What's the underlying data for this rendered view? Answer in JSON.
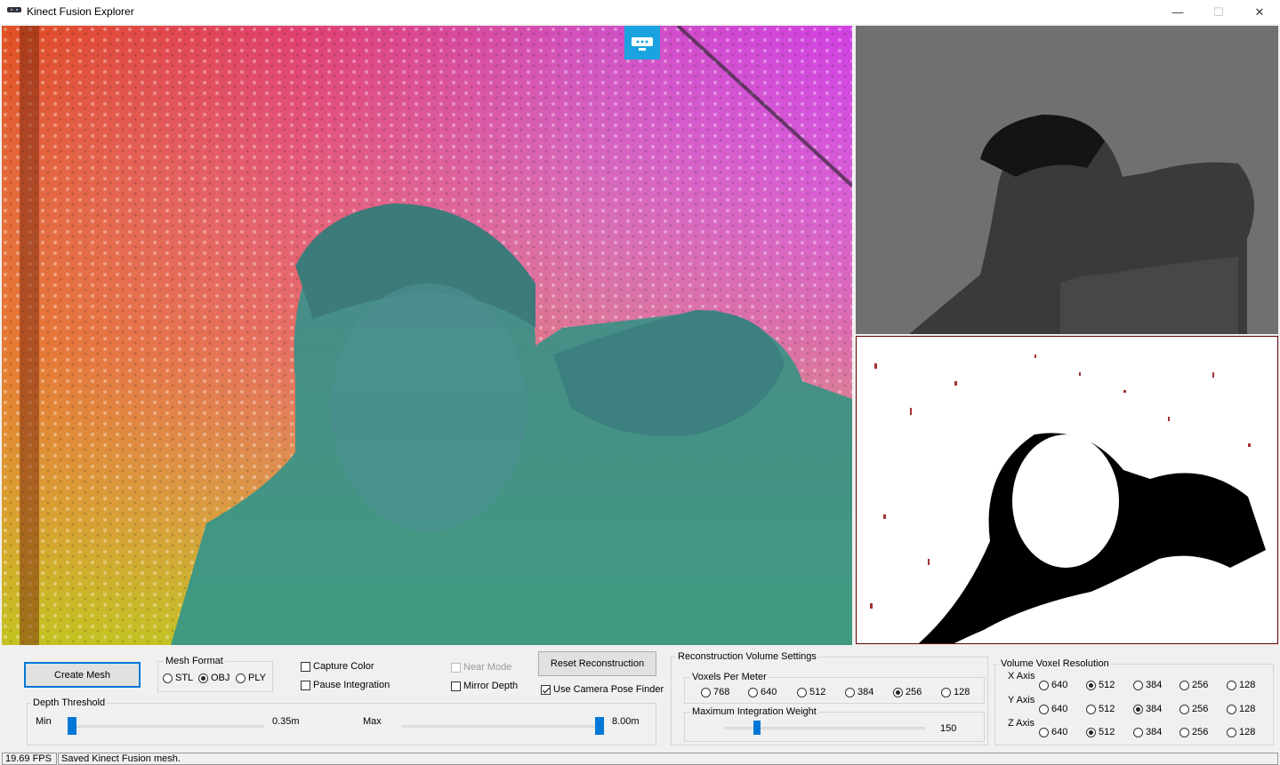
{
  "window": {
    "title": "Kinect Fusion Explorer",
    "minimize": "—",
    "maximize": "☐",
    "close": "✕"
  },
  "toolbar": {
    "create_mesh": "Create Mesh",
    "reset_reconstruction": "Reset Reconstruction"
  },
  "mesh_format": {
    "title": "Mesh Format",
    "options": [
      {
        "label": "STL",
        "selected": false
      },
      {
        "label": "OBJ",
        "selected": true
      },
      {
        "label": "PLY",
        "selected": false
      }
    ]
  },
  "checkboxes": {
    "capture_color": {
      "label": "Capture Color",
      "checked": false
    },
    "pause_integration": {
      "label": "Pause Integration",
      "checked": false
    },
    "near_mode": {
      "label": "Near Mode",
      "checked": false,
      "disabled": true
    },
    "mirror_depth": {
      "label": "Mirror Depth",
      "checked": false
    },
    "use_camera_pose_finder": {
      "label": "Use Camera Pose Finder",
      "checked": true
    }
  },
  "depth_threshold": {
    "title": "Depth Threshold",
    "min_label": "Min",
    "min_value": "0.35m",
    "max_label": "Max",
    "max_value": "8.00m",
    "min_fraction": 0.0,
    "max_fraction": 1.0
  },
  "reconstruction": {
    "title": "Reconstruction Volume Settings",
    "voxels_per_meter": {
      "title": "Voxels Per Meter",
      "options": [
        "768",
        "640",
        "512",
        "384",
        "256",
        "128"
      ],
      "selected": "256"
    },
    "max_integration_weight": {
      "title": "Maximum Integration Weight",
      "value": "150",
      "fraction": 0.15
    }
  },
  "voxel_resolution": {
    "title": "Volume Voxel Resolution",
    "options": [
      "640",
      "512",
      "384",
      "256",
      "128"
    ],
    "axes": [
      {
        "label": "X Axis",
        "selected": "512"
      },
      {
        "label": "Y Axis",
        "selected": "384"
      },
      {
        "label": "Z Axis",
        "selected": "512"
      }
    ]
  },
  "status": {
    "fps": "19.69 FPS",
    "message": "Saved Kinect Fusion mesh."
  }
}
